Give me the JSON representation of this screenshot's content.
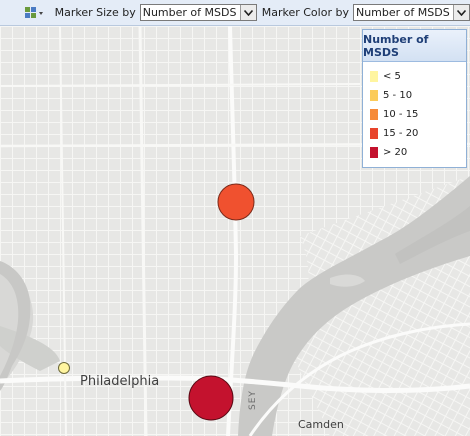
{
  "toolbar": {
    "marker_size_label": "Marker Size by",
    "marker_size_value": "Number of MSDS",
    "marker_color_label": "Marker Color by",
    "marker_color_value": "Number of MSDS",
    "layout_icon": "grid-layout-icon"
  },
  "legend": {
    "title": "Number of MSDS",
    "items": [
      {
        "label": "< 5",
        "color": "#fff5a0"
      },
      {
        "label": "5 - 10",
        "color": "#fbcb5a"
      },
      {
        "label": "10 - 15",
        "color": "#f68a38"
      },
      {
        "label": "15 - 20",
        "color": "#e8442b"
      },
      {
        "label": "> 20",
        "color": "#c4122e"
      }
    ]
  },
  "map": {
    "labels": {
      "philadelphia": "Philadelphia",
      "camden": "Camden",
      "road": "SEY"
    },
    "markers": [
      {
        "id": "north",
        "category": "15 - 20",
        "color": "#f0512f"
      },
      {
        "id": "west",
        "category": "< 5",
        "color": "#fff5a0"
      },
      {
        "id": "south",
        "category": "> 20",
        "color": "#c4122e"
      }
    ]
  }
}
